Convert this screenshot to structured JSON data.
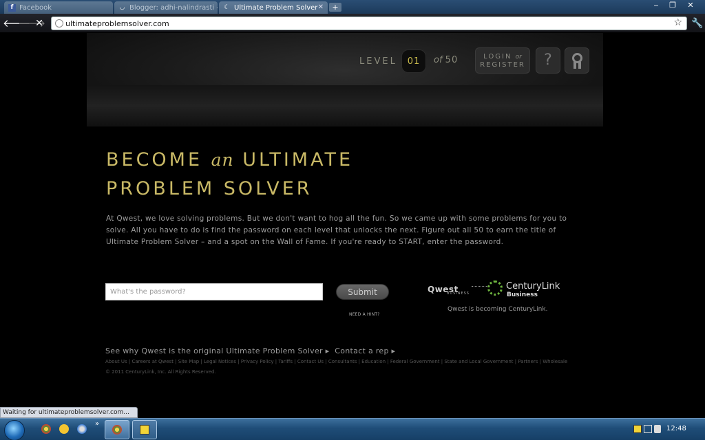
{
  "browser": {
    "tabs": [
      {
        "title": "Facebook",
        "icon": "facebook-icon"
      },
      {
        "title": "Blogger: adhi-nalindrasti - ...",
        "icon": "loading-icon"
      },
      {
        "title": "Ultimate Problem Solver",
        "icon": "moon-icon"
      }
    ],
    "new_tab": "+",
    "window_controls": {
      "minimize": "‒",
      "restore": "❐",
      "close": "✕"
    },
    "url": "ultimateproblemsolver.com",
    "status": "Waiting for ultimateproblemsolver.com..."
  },
  "header": {
    "level_label": "LEVEL",
    "level_current": "01",
    "level_of": "of",
    "level_total": "50",
    "login_label": "LOGIN",
    "login_or": "or",
    "register_label": "REGISTER",
    "help_label": "?"
  },
  "main": {
    "headline_line1_a": "BECOME",
    "headline_line1_an": "an",
    "headline_line1_b": "ULTIMATE",
    "headline_line2": "PROBLEM SOLVER",
    "intro": "At Qwest, we love solving problems. But we don't want to hog all the fun. So we came up with some problems for you to solve. All you have to do is find the password on each level that unlocks the next. Figure out all 50 to earn the title of Ultimate Problem Solver – and a spot on the Wall of Fame. If you're ready to START, enter the password.",
    "password_placeholder": "What's the password?",
    "submit_label": "Submit",
    "hint_label": "NEED A HINT?",
    "qwest_logo": "Qwest",
    "qwest_sub": "BUSINESS",
    "centurylink_logo": "CenturyLink",
    "centurylink_sub": "Business",
    "becoming_text": "Qwest is becoming CenturyLink."
  },
  "footer": {
    "link1": "See why Qwest is the original Ultimate Problem Solver ▸",
    "link2": "Contact a rep ▸",
    "links": "About Us | Careers at Qwest | Site Map | Legal Notices | Privacy Policy | Tariffs | Contact Us | Consultants | Education | Federal Government | State and Local Government | Partners | Wholesale",
    "copyright": "© 2011 CenturyLink, Inc. All Rights Reserved."
  },
  "taskbar": {
    "clock": "12:48",
    "overflow": "»"
  },
  "colors": {
    "accent_gold": "#c9b966",
    "level_gold": "#c8b94c",
    "centurylink_green": "#6db33f"
  }
}
